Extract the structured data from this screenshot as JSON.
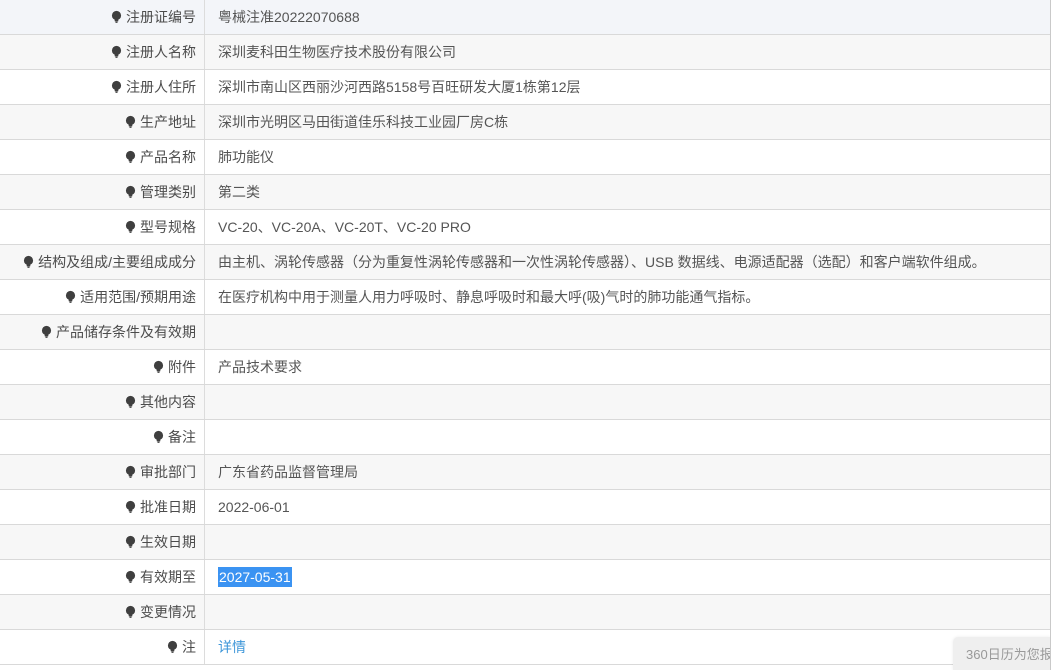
{
  "table": {
    "rows": [
      {
        "label": "注册证编号",
        "value": "粤械注准20222070688",
        "type": "text"
      },
      {
        "label": "注册人名称",
        "value": "深圳麦科田生物医疗技术股份有限公司",
        "type": "text"
      },
      {
        "label": "注册人住所",
        "value": "深圳市南山区西丽沙河西路5158号百旺研发大厦1栋第12层",
        "type": "text"
      },
      {
        "label": "生产地址",
        "value": "深圳市光明区马田街道佳乐科技工业园厂房C栋",
        "type": "text"
      },
      {
        "label": "产品名称",
        "value": "肺功能仪",
        "type": "text"
      },
      {
        "label": "管理类别",
        "value": "第二类",
        "type": "text"
      },
      {
        "label": "型号规格",
        "value": "VC-20、VC-20A、VC-20T、VC-20 PRO",
        "type": "text"
      },
      {
        "label": "结构及组成/主要组成成分",
        "value": "由主机、涡轮传感器（分为重复性涡轮传感器和一次性涡轮传感器）、USB 数据线、电源适配器（选配）和客户端软件组成。",
        "type": "text"
      },
      {
        "label": "适用范围/预期用途",
        "value": "在医疗机构中用于测量人用力呼吸时、静息呼吸时和最大呼(吸)气时的肺功能通气指标。",
        "type": "text"
      },
      {
        "label": "产品储存条件及有效期",
        "value": "",
        "type": "text"
      },
      {
        "label": "附件",
        "value": "产品技术要求",
        "type": "text"
      },
      {
        "label": "其他内容",
        "value": "",
        "type": "text"
      },
      {
        "label": "备注",
        "value": "",
        "type": "text"
      },
      {
        "label": "审批部门",
        "value": "广东省药品监督管理局",
        "type": "text"
      },
      {
        "label": "批准日期",
        "value": "2022-06-01",
        "type": "text"
      },
      {
        "label": "生效日期",
        "value": "",
        "type": "text"
      },
      {
        "label": "有效期至",
        "value": "2027-05-31",
        "type": "selected"
      },
      {
        "label": "变更情况",
        "value": "",
        "type": "text"
      },
      {
        "label": "注",
        "value": "详情",
        "type": "link",
        "icon": "lightbulb-icon"
      }
    ]
  },
  "tooltip": {
    "text": "360日历为您报"
  },
  "colors": {
    "row_stripe": "#f7f7f7",
    "row_hover": "#f3f5f9",
    "divider": "#d9d9d9",
    "selection_bg": "#3b93f2",
    "link": "#3e97d9",
    "text": "#555555",
    "tooltip_bg": "#efefef",
    "tooltip_text": "#999999"
  }
}
